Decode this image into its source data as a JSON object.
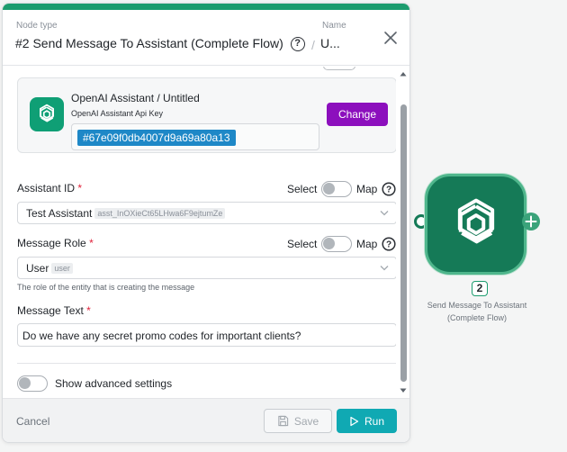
{
  "header": {
    "node_type_label": "Node type",
    "title": "#2 Send Message To Assistant (Complete Flow)",
    "name_label": "Name",
    "name_value": "U..."
  },
  "connection": {
    "title": "OpenAI Assistant / Untitled",
    "key_label": "OpenAI Assistant Api Key",
    "key_value": "#67e09f0db4007d9a69a80a13",
    "change_label": "Change"
  },
  "assistant_id": {
    "label": "Assistant ID",
    "required": "*",
    "select_label": "Select",
    "map_label": "Map",
    "value": "Test Assistant",
    "tag": "asst_InOXieCt65LHwa6F9ejtumZe"
  },
  "message_role": {
    "label": "Message Role",
    "required": "*",
    "select_label": "Select",
    "map_label": "Map",
    "value": "User",
    "tag": "user",
    "hint": "The role of the entity that is creating the message"
  },
  "message_text": {
    "label": "Message Text",
    "required": "*",
    "value": "Do we have any secret promo codes for important clients?"
  },
  "advanced": {
    "label": "Show advanced settings"
  },
  "footer": {
    "cancel_label": "Cancel",
    "save_label": "Save",
    "run_label": "Run"
  },
  "node": {
    "number": "2",
    "label": "Send Message To Assistant (Complete Flow)"
  },
  "colors": {
    "accent_green": "#1c9c6e",
    "node_green": "#157a57",
    "change_purple": "#8c0fbd",
    "run_teal": "#10a9b3",
    "key_blue": "#1e88c7",
    "required_red": "#e0213a"
  },
  "icons": {
    "help": "question-circle-icon",
    "close": "close-icon",
    "chevron": "chevron-down-icon",
    "openai": "openai-logo-icon",
    "save": "floppy-disk-icon",
    "run": "play-icon",
    "add": "plus-icon"
  }
}
